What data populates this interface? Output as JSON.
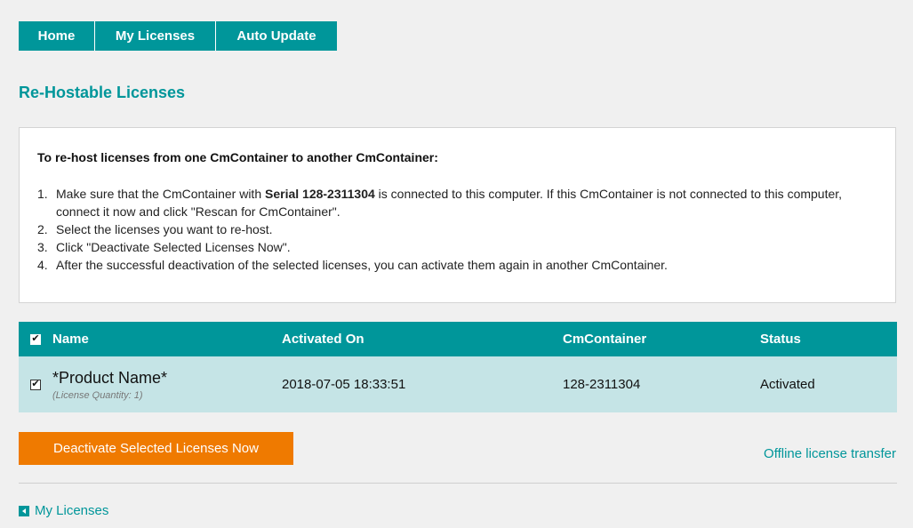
{
  "nav": {
    "tabs": [
      {
        "label": "Home"
      },
      {
        "label": "My Licenses"
      },
      {
        "label": "Auto Update"
      }
    ]
  },
  "page": {
    "title": "Re-Hostable Licenses"
  },
  "info": {
    "heading": "To re-host licenses from one CmContainer to another CmContainer:",
    "step1_num": "1.",
    "step1_pre": "Make sure that the CmContainer with ",
    "step1_bold": "Serial 128-2311304",
    "step1_post": " is connected to this computer. If this CmContainer is not connected to this computer, connect it now and click \"Rescan for CmContainer\".",
    "step2_num": "2.",
    "step2": "Select the licenses you want to re-host.",
    "step3_num": "3.",
    "step3": "Click \"Deactivate Selected Licenses Now\".",
    "step4_num": "4.",
    "step4": "After the successful deactivation of the selected licenses, you can activate them again in another CmContainer."
  },
  "table": {
    "headers": {
      "name": "Name",
      "activated_on": "Activated On",
      "cmcontainer": "CmContainer",
      "status": "Status"
    },
    "rows": [
      {
        "name": "*Product Name*",
        "quantity": "(License Quantity: 1)",
        "activated_on": "2018-07-05 18:33:51",
        "cmcontainer": "128-2311304",
        "status": "Activated",
        "checked": true
      }
    ],
    "check_glyph": "✔"
  },
  "actions": {
    "deactivate_label": "Deactivate Selected Licenses Now",
    "offline_label": "Offline license transfer",
    "back_label": "My Licenses"
  },
  "colors": {
    "accent": "#00969a",
    "action": "#ef7a00",
    "row_bg": "#c5e4e6"
  },
  "icons": {
    "back": "caret-left-icon",
    "checkbox": "checkbox-checked-icon"
  }
}
